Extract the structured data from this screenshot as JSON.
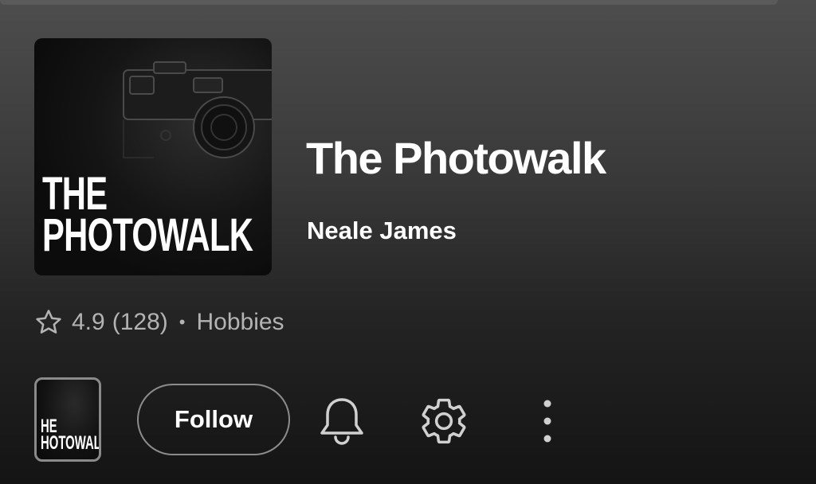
{
  "podcast": {
    "title": "The Photowalk",
    "author": "Neale James",
    "cover_line1": "THE",
    "cover_line2": "PHOTOWALK",
    "thumb_line1": "HE",
    "thumb_line2": "HOTOWAL"
  },
  "meta": {
    "rating": "4.9",
    "rating_count": "(128)",
    "separator": "•",
    "category": "Hobbies"
  },
  "actions": {
    "follow_label": "Follow",
    "icons": [
      "star-icon",
      "bell-icon",
      "gear-icon",
      "more-vertical-icon"
    ]
  },
  "colors": {
    "text_primary": "#ffffff",
    "text_secondary": "#b3b3b3",
    "outline": "#8c8c8c"
  }
}
